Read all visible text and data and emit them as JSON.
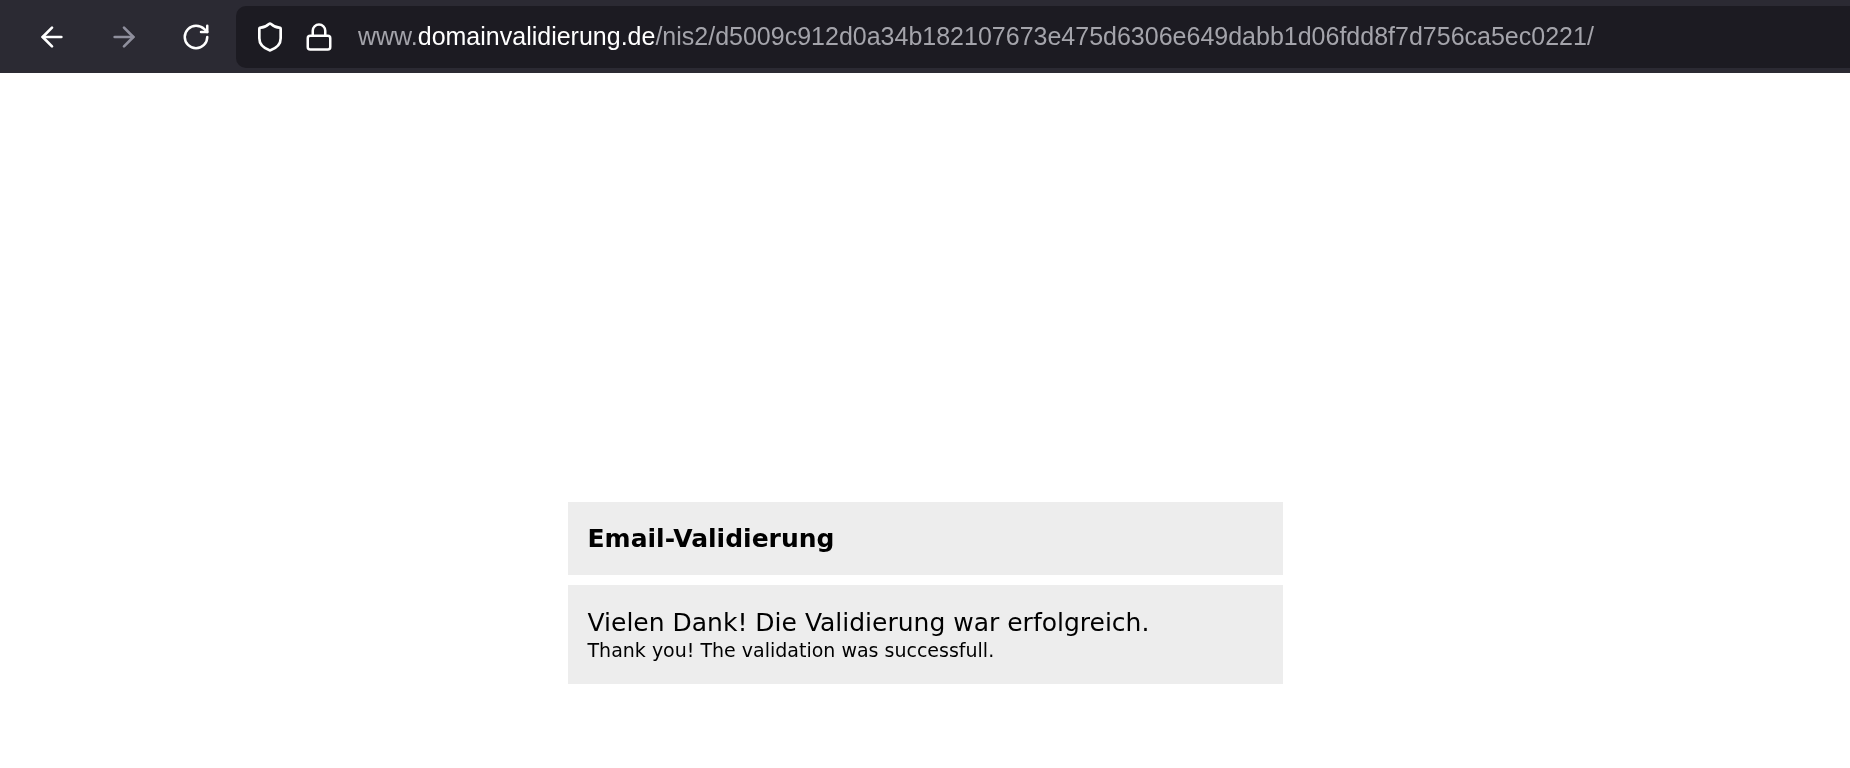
{
  "toolbar": {
    "back": {
      "disabled": false
    },
    "forward": {
      "disabled": true
    }
  },
  "address_bar": {
    "prefix": "www.",
    "domain": "domainvalidierung.de",
    "path": "/nis2/d5009c912d0a34b182107673e475d6306e649dabb1d06fdd8f7d756ca5ec0221/"
  },
  "card": {
    "title": "Email-Validierung",
    "message": "Vielen Dank! Die Validierung war erfolgreich.",
    "translation": "Thank you! The validation was successfull."
  }
}
